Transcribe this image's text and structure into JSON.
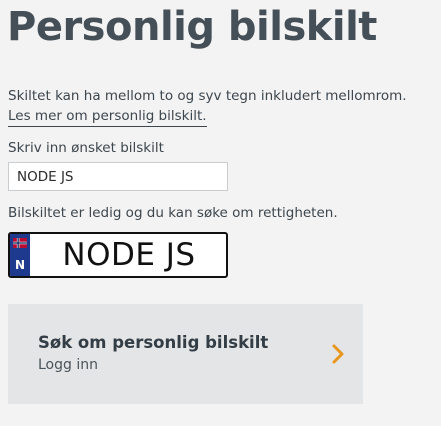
{
  "page": {
    "title": "Personlig bilskilt"
  },
  "intro": {
    "text": "Skiltet kan ha mellom to og syv tegn inkludert mellomrom.",
    "link_label": "Les mer om personlig bilskilt."
  },
  "form": {
    "input_label": "Skriv inn ønsket bilskilt",
    "input_value": "NODE JS",
    "status": "Bilskiltet er ledig og du kan søke om rettigheten."
  },
  "plate": {
    "country_code": "N",
    "text": "NODE JS",
    "band_color": "#1d3a8f",
    "flag_icon": "norway-flag-icon"
  },
  "apply": {
    "title": "Søk om personlig bilskilt",
    "subtitle": "Logg inn",
    "chevron_color": "#e8961e",
    "icon": "chevron-right-icon"
  }
}
